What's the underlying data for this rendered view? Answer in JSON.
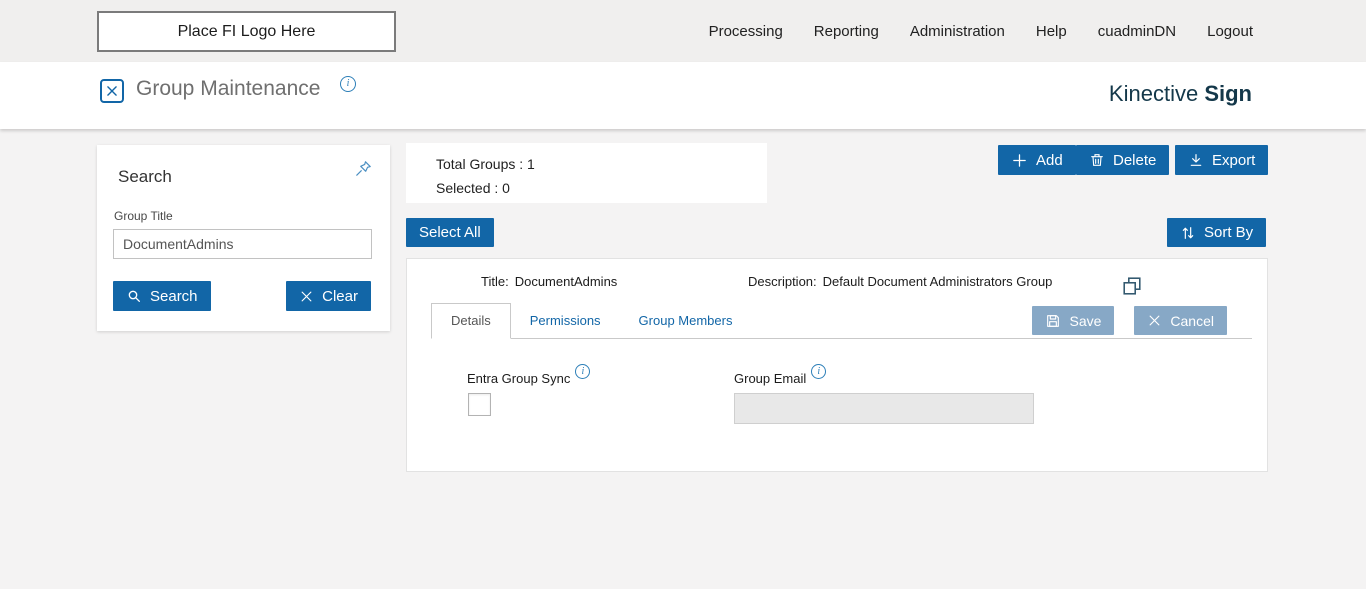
{
  "topbar": {
    "logo_placeholder": "Place FI Logo Here",
    "nav": [
      {
        "label": "Processing"
      },
      {
        "label": "Reporting"
      },
      {
        "label": "Administration"
      },
      {
        "label": "Help"
      },
      {
        "label": "cuadminDN"
      },
      {
        "label": "Logout"
      }
    ]
  },
  "header": {
    "page_title": "Group Maintenance",
    "brand_primary": "Kinective",
    "brand_secondary": "Sign"
  },
  "icons": {
    "info": "i"
  },
  "search_panel": {
    "title": "Search",
    "group_title_label": "Group Title",
    "group_title_value": "DocumentAdmins",
    "search_button": "Search",
    "clear_button": "Clear"
  },
  "summary": {
    "total_groups": "Total Groups : 1",
    "selected": "Selected : 0"
  },
  "toolbar": {
    "add_label": "Add",
    "delete_label": "Delete",
    "export_label": "Export",
    "select_all_label": "Select All",
    "sort_by_label": "Sort By"
  },
  "group_card": {
    "title_label": "Title:",
    "title_value": "DocumentAdmins",
    "description_label": "Description:",
    "description_value": "Default Document Administrators Group",
    "tabs": [
      {
        "label": "Details",
        "active": true
      },
      {
        "label": "Permissions",
        "active": false
      },
      {
        "label": "Group Members",
        "active": false
      }
    ],
    "save_label": "Save",
    "cancel_label": "Cancel",
    "fields": {
      "entra_group_sync_label": "Entra Group Sync",
      "entra_group_sync_checked": false,
      "group_email_label": "Group Email",
      "group_email_value": ""
    }
  },
  "colors": {
    "primary_blue": "#1266a7",
    "muted_blue": "#87a8c6",
    "brand_dark": "#14384a",
    "topbar_bg": "#f0efee",
    "main_bg": "#f4f3f3"
  }
}
